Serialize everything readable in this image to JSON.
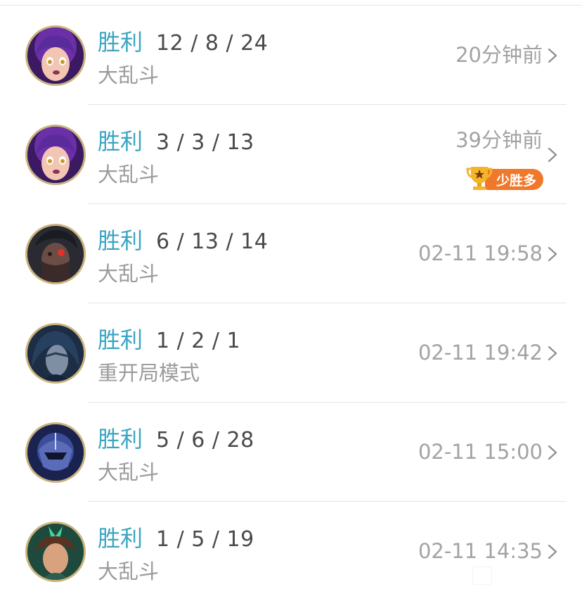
{
  "matches": [
    {
      "result": "胜利",
      "kda": "12 / 8 / 24",
      "mode": "大乱斗",
      "time": "20分钟前",
      "champion_icon": "neeko-avatar"
    },
    {
      "result": "胜利",
      "kda": "3 / 3 / 13",
      "mode": "大乱斗",
      "time": "39分钟前",
      "champion_icon": "neeko-avatar",
      "badge": "少胜多"
    },
    {
      "result": "胜利",
      "kda": "6 / 13 / 14",
      "mode": "大乱斗",
      "time": "02-11 19:58",
      "champion_icon": "kayn-avatar"
    },
    {
      "result": "胜利",
      "kda": "1 / 2 / 1",
      "mode": "重开局模式",
      "time": "02-11 19:42",
      "champion_icon": "hooded-champion-avatar"
    },
    {
      "result": "胜利",
      "kda": "5 / 6 / 28",
      "mode": "大乱斗",
      "time": "02-11 15:00",
      "champion_icon": "armored-helmet-avatar"
    },
    {
      "result": "胜利",
      "kda": "1 / 5 / 19",
      "mode": "大乱斗",
      "time": "02-11 14:35",
      "champion_icon": "green-crown-avatar"
    }
  ],
  "colors": {
    "result": "#3aa5c3",
    "kda": "#4a4a4a",
    "secondary": "#9b9b9b",
    "badge": "#f0782b",
    "avatar_border": "#c9b37e"
  }
}
